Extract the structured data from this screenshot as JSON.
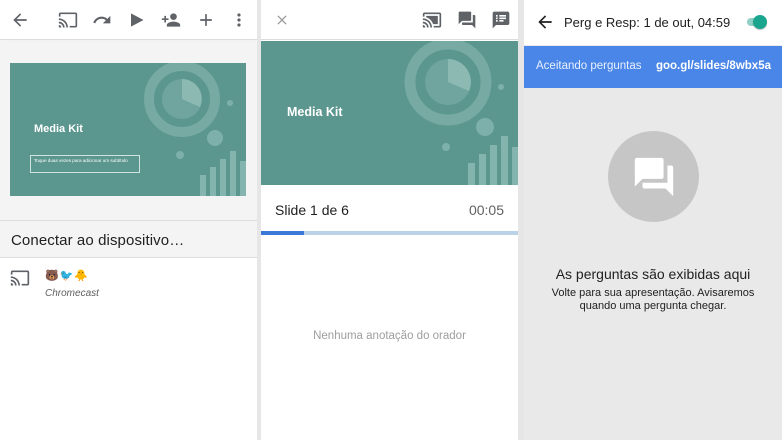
{
  "editor": {
    "toolbar_icons": [
      "back-arrow-icon",
      "cast-icon",
      "redo-icon",
      "play-icon",
      "add-person-icon",
      "add-icon",
      "more-vert-icon"
    ],
    "slide": {
      "title": "Media Kit",
      "subtitle_placeholder": "Toque duas vezes para adicionar um subtítulo"
    },
    "connect_label": "Conectar ao dispositivo…",
    "device": {
      "emoji": "🐻🐦🐥",
      "name": "Chromecast"
    }
  },
  "presenter": {
    "toolbar_icons": [
      "close-icon",
      "cast-icon",
      "questions-icon",
      "speaker-notes-icon"
    ],
    "slide_title": "Media Kit",
    "slide_counter": "Slide 1 de 6",
    "timer": "00:05",
    "progress": 0.167,
    "notes_empty": "Nenhuma anotação do orador"
  },
  "qa": {
    "title": "Perg e Resp:  1 de out, 04:59",
    "toggle_on": true,
    "accepting_label": "Aceitando perguntas",
    "short_link": "goo.gl/slides/8wbx5a",
    "empty_title": "As perguntas são exibidas aqui",
    "empty_body": [
      "Volte para sua apresentação. Avisaremos",
      "quando uma pergunta chegar."
    ]
  },
  "colors": {
    "slide_teal": "#5b968f",
    "accent_blue": "#4a86e8",
    "progress_blue": "#3c78d8",
    "toggle_teal": "#1aa58e"
  }
}
